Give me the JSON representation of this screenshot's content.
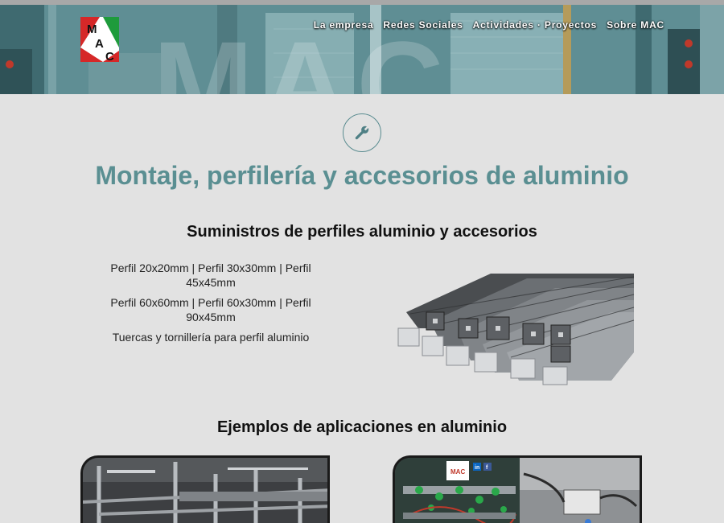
{
  "header": {
    "logo_letters": [
      "M",
      "A",
      "C"
    ],
    "nav": [
      {
        "label": "La empresa"
      },
      {
        "label": "Redes Sociales"
      },
      {
        "label": "Actividades · Proyectos"
      },
      {
        "label": "Sobre MAC"
      }
    ],
    "hero_watermark": "MAC"
  },
  "main": {
    "icon": "wrench-icon",
    "title": "Montaje, perfilería y accesorios de aluminio",
    "section1": {
      "title": "Suministros de perfiles aluminio y accesorios",
      "items": [
        "Perfil 20x20mm | Perfil 30x30mm | Perfil 45x45mm",
        "Perfil 60x60mm | Perfil 60x30mm | Perfil 90x45mm",
        "Tuercas y tornillería para perfil aluminio"
      ]
    },
    "section2": {
      "title": "Ejemplos de aplicaciones en aluminio",
      "card2_social": [
        "in",
        "f"
      ]
    }
  },
  "colors": {
    "accent": "#5a8f92",
    "background": "#e2e2e2",
    "hero": "#5b8a90"
  }
}
